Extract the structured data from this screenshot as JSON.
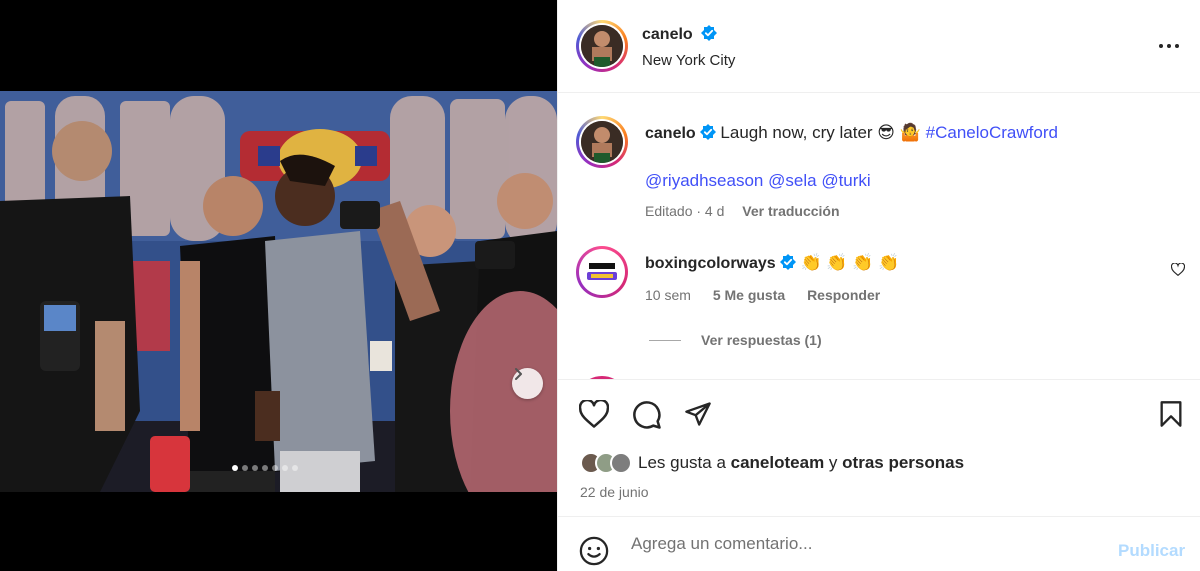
{
  "post": {
    "username": "canelo",
    "location": "New York City",
    "caption": "Laugh now, cry later 😎 🤷",
    "hashtag": "#CaneloCrawford",
    "mentions": [
      "@riyadhseason",
      "@sela",
      "@turki"
    ],
    "edited_meta": "Editado · 4 d",
    "translate_label": "Ver traducción",
    "carousel_dots": 7
  },
  "comment": {
    "username": "boxingcolorways",
    "text": "👏 👏 👏 👏",
    "age": "10 sem",
    "likes": "5 Me gusta",
    "reply_label": "Responder",
    "view_replies": "Ver respuestas (1)"
  },
  "likes": {
    "prefix": "Les gusta a",
    "user": "caneloteam",
    "conj": "y",
    "others": "otras personas"
  },
  "date": "22 de junio",
  "composer": {
    "placeholder": "Agrega un comentario...",
    "post_label": "Publicar"
  },
  "colors": {
    "link": "#4150f7",
    "verified": "#0095f6",
    "post_disabled": "#b3dbff"
  },
  "icons": [
    "chevron-right-icon",
    "verified-icon",
    "more-icon",
    "heart-icon",
    "comment-icon",
    "share-icon",
    "bookmark-icon",
    "emoji-icon"
  ]
}
